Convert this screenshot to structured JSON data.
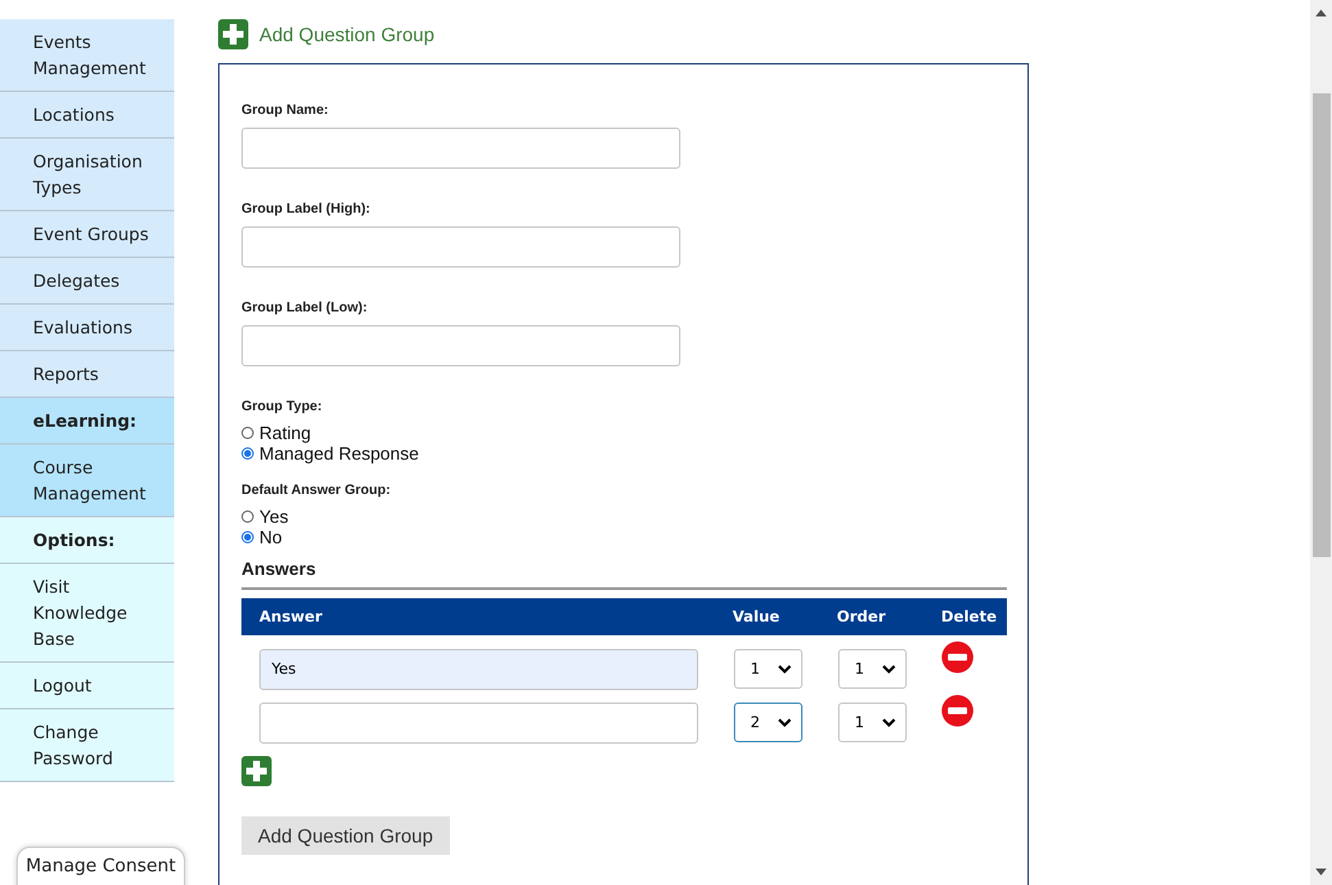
{
  "sidebar": {
    "items": [
      {
        "label": "Events Management",
        "kind": "link",
        "color": "#d5ebfc"
      },
      {
        "label": "Locations",
        "kind": "link",
        "color": "#d5ebfc"
      },
      {
        "label": "Organisation Types",
        "kind": "link",
        "color": "#d5ebfc"
      },
      {
        "label": "Event Groups",
        "kind": "link",
        "color": "#d5ebfc"
      },
      {
        "label": "Delegates",
        "kind": "link",
        "color": "#d5ebfc"
      },
      {
        "label": "Evaluations",
        "kind": "link",
        "color": "#d5ebfc"
      },
      {
        "label": "Reports",
        "kind": "link",
        "color": "#d5ebfc"
      },
      {
        "label": "eLearning:",
        "kind": "heading",
        "color": "#b4e4fb"
      },
      {
        "label": "Course Management",
        "kind": "link",
        "color": "#b4e4fb"
      },
      {
        "label": "Options:",
        "kind": "heading",
        "color": "#e0fbfe"
      },
      {
        "label": "Visit Knowledge Base",
        "kind": "link",
        "color": "#e0fbfe"
      },
      {
        "label": "Logout",
        "kind": "link",
        "color": "#e0fbfe"
      },
      {
        "label": "Change Password",
        "kind": "link",
        "color": "#e0fbfe"
      }
    ]
  },
  "add_link": {
    "label": "Add Question Group"
  },
  "form": {
    "fields": [
      {
        "label": "Group Name:"
      },
      {
        "label": "Group Label (High):"
      },
      {
        "label": "Group Label (Low):"
      }
    ],
    "radio_groups": [
      {
        "label": "Group Type:",
        "options": [
          {
            "label": "Rating",
            "selected": false
          },
          {
            "label": "Managed Response",
            "selected": true
          }
        ]
      },
      {
        "label": "Default Answer Group:",
        "options": [
          {
            "label": "Yes",
            "selected": false
          },
          {
            "label": "No",
            "selected": true
          }
        ]
      }
    ],
    "answers": {
      "heading": "Answers",
      "columns": [
        "Answer",
        "Value",
        "Order",
        "Delete"
      ],
      "rows": [
        {
          "answer": "Yes",
          "autofilled": true,
          "value": "1",
          "value_focused": false,
          "order": "1"
        },
        {
          "autofilled": false,
          "value": "2",
          "value_focused": true,
          "order": "1"
        }
      ]
    },
    "submit_button": "Add Question Group"
  },
  "consent_button": "Manage Consent"
}
